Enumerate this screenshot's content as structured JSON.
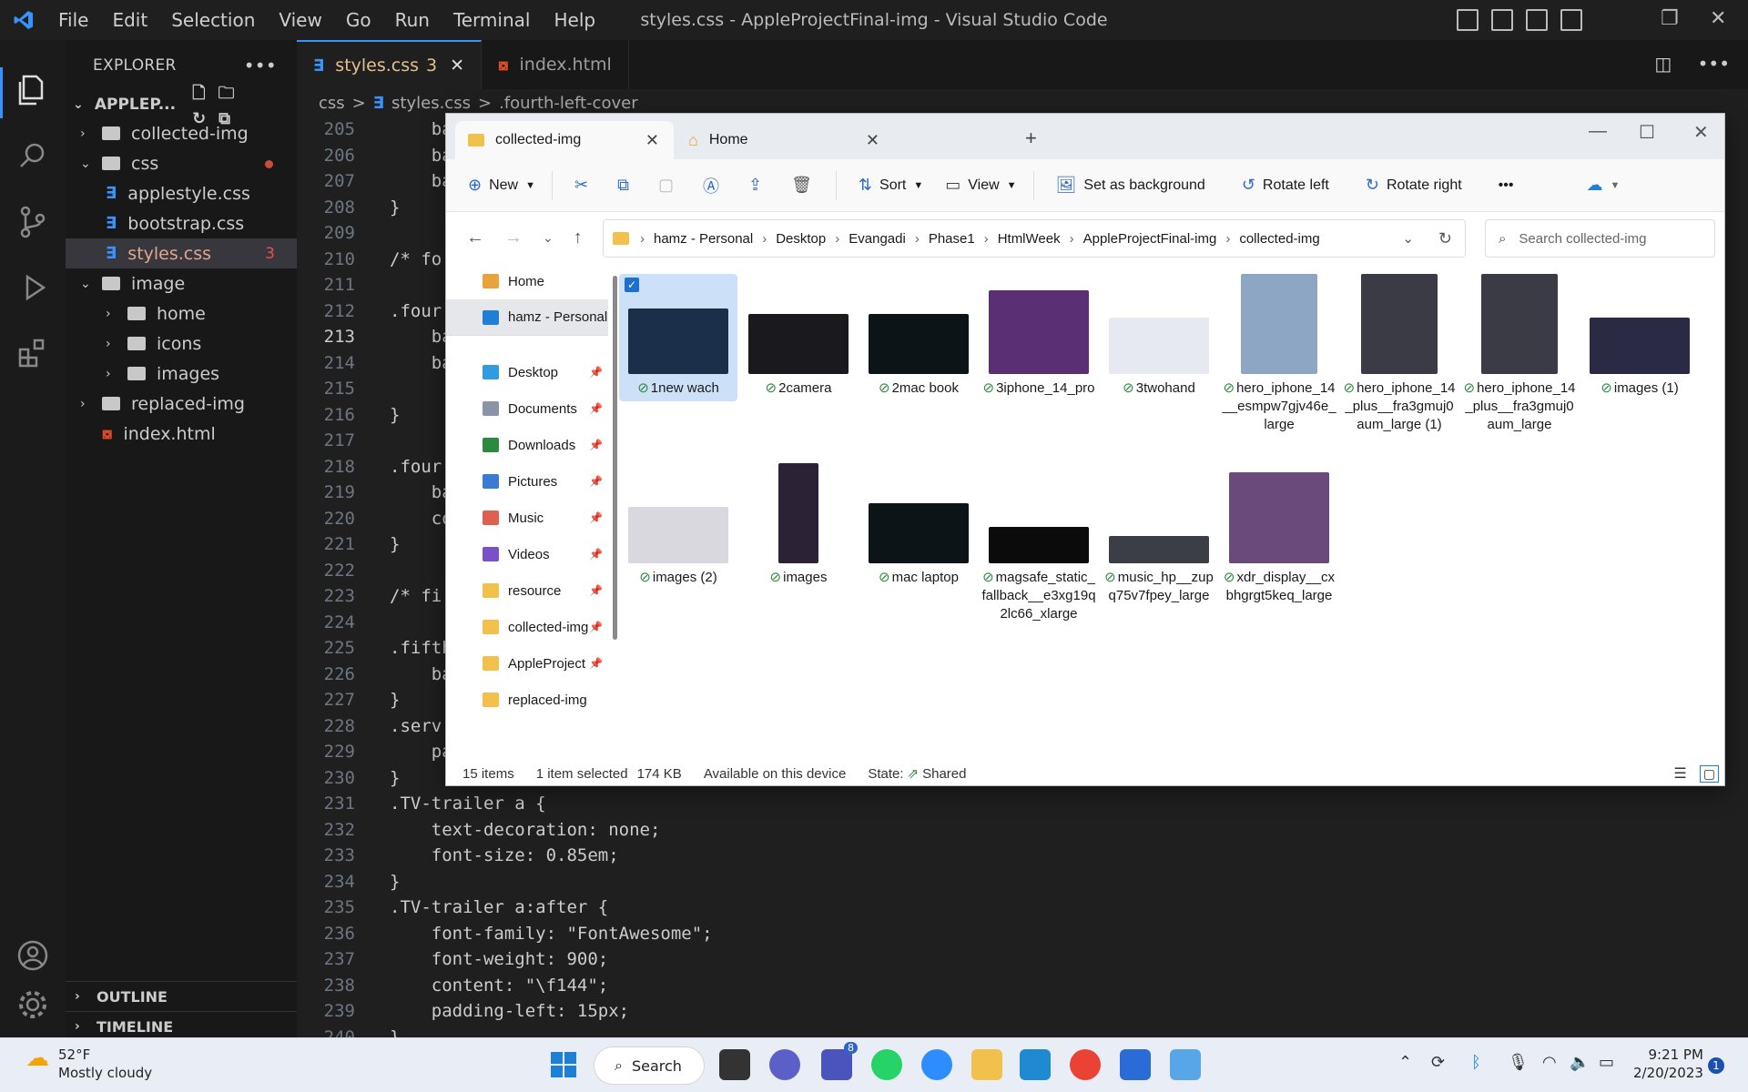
{
  "vscode": {
    "window_title": "styles.css - AppleProjectFinal-img - Visual Studio Code",
    "menu": [
      "File",
      "Edit",
      "Selection",
      "View",
      "Go",
      "Run",
      "Terminal",
      "Help"
    ],
    "explorer_title": "EXPLORER",
    "root": "APPLEP...",
    "tree": [
      {
        "label": "collected-img",
        "type": "folder",
        "chevron": ">"
      },
      {
        "label": "css",
        "type": "folder",
        "chevron": "v"
      },
      {
        "label": "applestyle.css",
        "type": "css"
      },
      {
        "label": "bootstrap.css",
        "type": "css"
      },
      {
        "label": "styles.css",
        "type": "css",
        "badge": "3"
      },
      {
        "label": "image",
        "type": "folder",
        "chevron": "v"
      },
      {
        "label": "home",
        "type": "folder",
        "chevron": ">"
      },
      {
        "label": "icons",
        "type": "folder",
        "chevron": ">"
      },
      {
        "label": "images",
        "type": "folder",
        "chevron": ">"
      },
      {
        "label": "replaced-img",
        "type": "folder",
        "chevron": ">"
      },
      {
        "label": "index.html",
        "type": "html"
      }
    ],
    "outline": "OUTLINE",
    "timeline": "TIMELINE",
    "tabs": [
      {
        "label": "styles.css",
        "badge": "3"
      },
      {
        "label": "index.html"
      }
    ],
    "breadcrumb": [
      "css",
      ">",
      "styles.css",
      ">",
      ".fourth-left-cover"
    ],
    "code": [
      {
        "n": "205",
        "t": "    bac"
      },
      {
        "n": "206",
        "t": "    bac"
      },
      {
        "n": "207",
        "t": "    bac"
      },
      {
        "n": "208",
        "t": "}"
      },
      {
        "n": "209",
        "t": ""
      },
      {
        "n": "210",
        "t": "/* fo"
      },
      {
        "n": "211",
        "t": ""
      },
      {
        "n": "212",
        "t": ".four"
      },
      {
        "n": "213",
        "t": "    bac"
      },
      {
        "n": "214",
        "t": "    bac"
      },
      {
        "n": "215",
        "t": ""
      },
      {
        "n": "216",
        "t": "}"
      },
      {
        "n": "217",
        "t": ""
      },
      {
        "n": "218",
        "t": ".four"
      },
      {
        "n": "219",
        "t": "    bac"
      },
      {
        "n": "220",
        "t": "    colo"
      },
      {
        "n": "221",
        "t": "}"
      },
      {
        "n": "222",
        "t": ""
      },
      {
        "n": "223",
        "t": "/* fi"
      },
      {
        "n": "224",
        "t": ""
      },
      {
        "n": "225",
        "t": ".fifth"
      },
      {
        "n": "226",
        "t": "    bac"
      },
      {
        "n": "227",
        "t": "}"
      },
      {
        "n": "228",
        "t": ".serv"
      },
      {
        "n": "229",
        "t": "    padd"
      },
      {
        "n": "230",
        "t": "}"
      },
      {
        "n": "231",
        "t": ".TV-trailer a {"
      },
      {
        "n": "232",
        "t": "    text-decoration: none;"
      },
      {
        "n": "233",
        "t": "    font-size: 0.85em;"
      },
      {
        "n": "234",
        "t": "}"
      },
      {
        "n": "235",
        "t": ".TV-trailer a:after {"
      },
      {
        "n": "236",
        "t": "    font-family: \"FontAwesome\";"
      },
      {
        "n": "237",
        "t": "    font-weight: 900;"
      },
      {
        "n": "238",
        "t": "    content: \"\\f144\";"
      },
      {
        "n": "239",
        "t": "    padding-left: 15px;"
      },
      {
        "n": "240",
        "t": "}"
      }
    ]
  },
  "explorer": {
    "tabs": [
      {
        "label": "collected-img"
      },
      {
        "label": "Home"
      }
    ],
    "toolbar": {
      "new": "New",
      "sort": "Sort",
      "view": "View",
      "set_bg": "Set as background",
      "rotate_left": "Rotate left",
      "rotate_right": "Rotate right",
      "more": "•••"
    },
    "address": [
      "hamz - Personal",
      "Desktop",
      "Evangadi",
      "Phase1",
      "HtmlWeek",
      "AppleProjectFinal-img",
      "collected-img"
    ],
    "search_placeholder": "Search collected-img",
    "nav": [
      {
        "label": "Home",
        "color": "#e8a33a"
      },
      {
        "label": "hamz - Personal",
        "color": "#1d7fd6"
      },
      {
        "label": "Desktop",
        "color": "#2f9be0",
        "pin": true
      },
      {
        "label": "Documents",
        "color": "#8a94a6",
        "pin": true
      },
      {
        "label": "Downloads",
        "color": "#2b8a3e",
        "pin": true
      },
      {
        "label": "Pictures",
        "color": "#3b7bd4",
        "pin": true
      },
      {
        "label": "Music",
        "color": "#e0604f",
        "pin": true
      },
      {
        "label": "Videos",
        "color": "#7a4fc8",
        "pin": true
      },
      {
        "label": "resource",
        "color": "#f2c14b",
        "pin": true
      },
      {
        "label": "collected-img",
        "color": "#f2c14b",
        "pin": true
      },
      {
        "label": "AppleProject",
        "color": "#f2c14b",
        "pin": true
      },
      {
        "label": "replaced-img",
        "color": "#f2c14b"
      }
    ],
    "files": [
      "1new wach",
      "2camera",
      "2mac book",
      "3iphone_14_pro",
      "3twohand",
      "hero_iphone_14__esmpw7gjv46e_large",
      "hero_iphone_14_plus__fra3gmuj0aum_large (1)",
      "hero_iphone_14_plus__fra3gmuj0aum_large",
      "images (1)",
      "images (2)",
      "images",
      "mac laptop",
      "magsafe_static_fallback__e3xg19q2lc66_xlarge",
      "music_hp__zupq75v7fpey_large",
      "xdr_display__cxbhgrgt5keq_large"
    ],
    "status": {
      "count": "15 items",
      "selected": "1 item selected",
      "size": "174 KB",
      "availability": "Available on this device",
      "state_label": "State:",
      "state": "Shared"
    }
  },
  "taskbar": {
    "temp": "52°F",
    "weather": "Mostly cloudy",
    "search": "Search",
    "time": "9:21 PM",
    "date": "2/20/2023",
    "notif": "1",
    "teams_badge": "8"
  }
}
